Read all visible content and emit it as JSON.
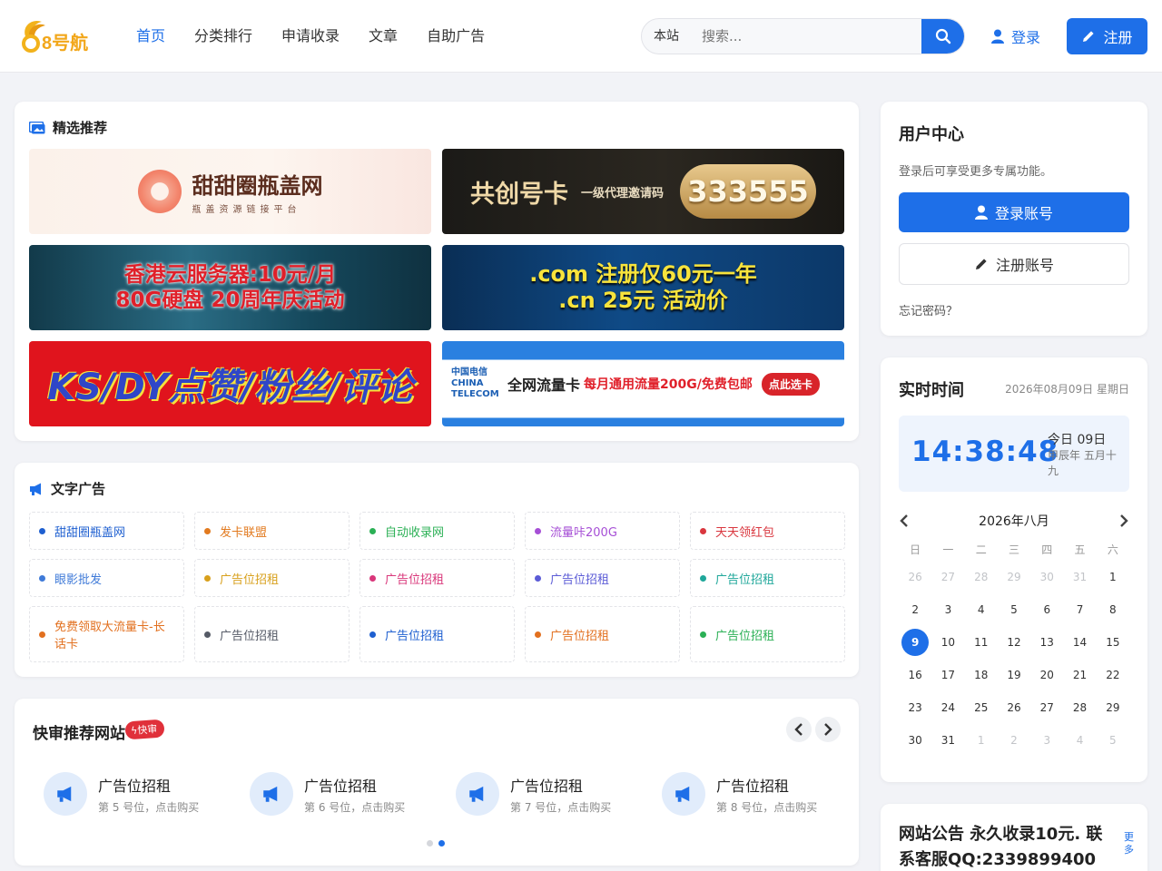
{
  "header": {
    "logo_text": "8号航",
    "nav": [
      "首页",
      "分类排行",
      "申请收录",
      "文章",
      "自助广告"
    ],
    "search_scope": "本站",
    "search_placeholder": "搜索...",
    "login_label": "登录",
    "register_label": "注册",
    "accent": "#1e6fe8"
  },
  "featured": {
    "title": "精选推荐",
    "banners": [
      {
        "title": "甜甜圈瓶盖网",
        "subtitle": "瓶盖资源链接平台"
      },
      {
        "title": "共创号卡",
        "subtitle": "一级代理邀请码",
        "code": "333555"
      },
      {
        "line1": "香港云服务器:10元/月",
        "line2": "80G硬盘 20周年庆活动"
      },
      {
        "line1": ".com 注册仅60元一年",
        "line2": ".cn 25元 活动价"
      },
      {
        "title": "KS/DY点赞/粉丝/评论"
      },
      {
        "brand": "中国电信 CHINA TELECOM",
        "title": "全网流量卡",
        "subtitle": "每月通用流量200G/免费包邮",
        "button": "点此选卡"
      }
    ]
  },
  "text_ads": {
    "title": "文字广告",
    "items": [
      {
        "label": "甜甜圈瓶盖网",
        "color": "#1e5fd0"
      },
      {
        "label": "发卡联盟",
        "color": "#e27a1f"
      },
      {
        "label": "自动收录网",
        "color": "#2bb055"
      },
      {
        "label": "流量咔200G",
        "color": "#a64fd6"
      },
      {
        "label": "天天领红包",
        "color": "#d9363e"
      },
      {
        "label": "眼影批发",
        "color": "#3f7ad8"
      },
      {
        "label": "广告位招租",
        "color": "#d8a01c"
      },
      {
        "label": "广告位招租",
        "color": "#d9367a"
      },
      {
        "label": "广告位招租",
        "color": "#5b5bd6"
      },
      {
        "label": "广告位招租",
        "color": "#1fa79a"
      },
      {
        "label": "免费领取大流量卡-长话卡",
        "color": "#e2701f"
      },
      {
        "label": "广告位招租",
        "color": "#555a66"
      },
      {
        "label": "广告位招租",
        "color": "#1e5fd0"
      },
      {
        "label": "广告位招租",
        "color": "#e2701f"
      },
      {
        "label": "广告位招租",
        "color": "#2bb055"
      }
    ]
  },
  "quick": {
    "title": "快审推荐网站",
    "badge": "快审",
    "sites": [
      {
        "name": "广告位招租",
        "sub": "第 5 号位，点击购买"
      },
      {
        "name": "广告位招租",
        "sub": "第 6 号位，点击购买"
      },
      {
        "name": "广告位招租",
        "sub": "第 7 号位，点击购买"
      },
      {
        "name": "广告位招租",
        "sub": "第 8 号位，点击购买"
      }
    ],
    "page": 2,
    "pages": 2
  },
  "user_center": {
    "title": "用户中心",
    "desc": "登录后可享受更多专属功能。",
    "login_button": "登录账号",
    "register_button": "注册账号",
    "forgot": "忘记密码？"
  },
  "time": {
    "title": "实时时间",
    "date": "2026年08月09日 星期日",
    "clock": "14:38:48",
    "today": "今日 09日",
    "lunar": "甲辰年 五月十九",
    "month_label": "2026年八月",
    "weekdays": [
      "日",
      "一",
      "二",
      "三",
      "四",
      "五",
      "六"
    ],
    "days": [
      {
        "d": "26",
        "m": true
      },
      {
        "d": "27",
        "m": true
      },
      {
        "d": "28",
        "m": true
      },
      {
        "d": "29",
        "m": true
      },
      {
        "d": "30",
        "m": true
      },
      {
        "d": "31",
        "m": true
      },
      {
        "d": "1"
      },
      {
        "d": "2"
      },
      {
        "d": "3"
      },
      {
        "d": "4"
      },
      {
        "d": "5"
      },
      {
        "d": "6"
      },
      {
        "d": "7"
      },
      {
        "d": "8"
      },
      {
        "d": "9",
        "today": true
      },
      {
        "d": "10"
      },
      {
        "d": "11"
      },
      {
        "d": "12"
      },
      {
        "d": "13"
      },
      {
        "d": "14"
      },
      {
        "d": "15"
      },
      {
        "d": "16"
      },
      {
        "d": "17"
      },
      {
        "d": "18"
      },
      {
        "d": "19"
      },
      {
        "d": "20"
      },
      {
        "d": "21"
      },
      {
        "d": "22"
      },
      {
        "d": "23"
      },
      {
        "d": "24"
      },
      {
        "d": "25"
      },
      {
        "d": "26"
      },
      {
        "d": "27"
      },
      {
        "d": "28"
      },
      {
        "d": "29"
      },
      {
        "d": "30"
      },
      {
        "d": "31"
      },
      {
        "d": "1",
        "m": true
      },
      {
        "d": "2",
        "m": true
      },
      {
        "d": "3",
        "m": true
      },
      {
        "d": "4",
        "m": true
      },
      {
        "d": "5",
        "m": true
      }
    ]
  },
  "notice": {
    "title": "网站公告 永久收录10元. 联系客服QQ:2339899400",
    "more": "更多"
  }
}
